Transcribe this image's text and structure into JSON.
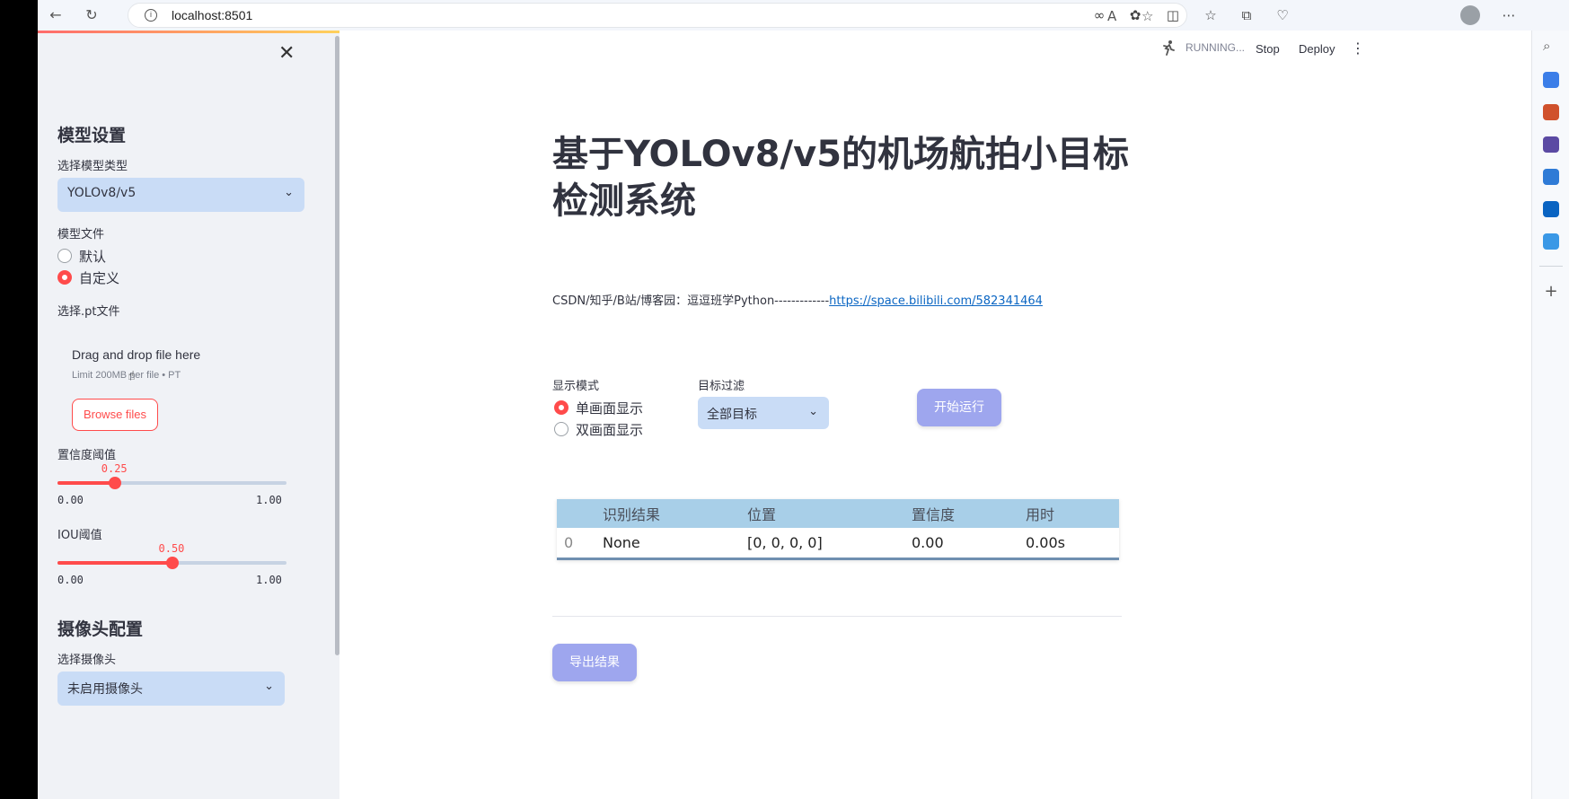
{
  "browser": {
    "url": "localhost:8501"
  },
  "header": {
    "status": "RUNNING...",
    "stop_label": "Stop",
    "deploy_label": "Deploy"
  },
  "sidebar": {
    "model_section_title": "模型设置",
    "model_type_label": "选择模型类型",
    "model_type_value": "YOLOv8/v5",
    "model_file_label": "模型文件",
    "model_file_options": [
      "默认",
      "自定义"
    ],
    "model_file_selected": "自定义",
    "pt_file_label": "选择.pt文件",
    "uploader": {
      "main_text": "Drag and drop file here",
      "sub_text": "Limit 200MB per file • PT",
      "browse_label": "Browse files"
    },
    "confidence": {
      "label": "置信度阈值",
      "value": "0.25",
      "value_num": 0.25,
      "min": "0.00",
      "max": "1.00"
    },
    "iou": {
      "label": "IOU阈值",
      "value": "0.50",
      "value_num": 0.5,
      "min": "0.00",
      "max": "1.00"
    },
    "camera_section_title": "摄像头配置",
    "camera_label": "选择摄像头",
    "camera_value": "未启用摄像头"
  },
  "main": {
    "title": "基于YOLOv8/v5的机场航拍小目标检测系统",
    "info_prefix": "CSDN/知乎/B站/博客园：逗逗班学Python-------------",
    "info_link": "https://space.bilibili.com/582341464",
    "display_mode_label": "显示模式",
    "display_mode_options": [
      "单画面显示",
      "双画面显示"
    ],
    "display_mode_selected": "单画面显示",
    "filter_label": "目标过滤",
    "filter_value": "全部目标",
    "start_button": "开始运行",
    "table": {
      "headers": [
        "",
        "识别结果",
        "位置",
        "置信度",
        "用时"
      ],
      "rows": [
        [
          "0",
          "None",
          "[0, 0, 0, 0]",
          "0.00",
          "0.00s"
        ]
      ]
    },
    "export_button": "导出结果"
  },
  "colors": {
    "accent": "#ff4b4b",
    "select_bg": "#c9dcf6",
    "button_purple": "#9ea6ee",
    "table_header": "#a8cfe8"
  }
}
